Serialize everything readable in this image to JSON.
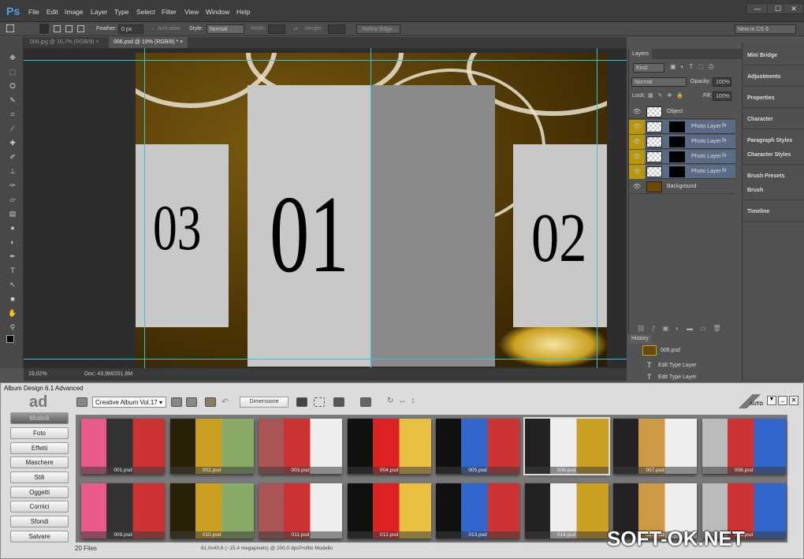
{
  "app": {
    "logo": "Ps",
    "menu": [
      "File",
      "Edit",
      "Image",
      "Layer",
      "Type",
      "Select",
      "Filter",
      "View",
      "Window",
      "Help"
    ],
    "window_controls": [
      "—",
      "☐",
      "✕"
    ]
  },
  "options": {
    "feather_label": "Feather:",
    "feather_value": "0 px",
    "antialias_label": "Anti-alias",
    "style_label": "Style:",
    "style_value": "Normal",
    "width_label": "Width:",
    "height_label": "Height:",
    "refine_edge": "Refine Edge...",
    "workspace": "New in CS 6"
  },
  "tabs": [
    {
      "label": "006.jpg @ 16,7% (RGB/8)",
      "close": "×"
    },
    {
      "label": "006.psd @ 19% (RGB/8) *",
      "close": "×"
    }
  ],
  "canvas": {
    "numbers": [
      "03",
      "01",
      "02"
    ]
  },
  "status": {
    "zoom": "19,02%",
    "doc": "Doc: 43,9M/201,6M"
  },
  "layers": {
    "tab": "Layers",
    "kind": "Kind",
    "blend": "Normal",
    "opacity_label": "Opacity:",
    "opacity": "100%",
    "lock_label": "Lock:",
    "fill_label": "Fill:",
    "fill": "100%",
    "items": [
      {
        "name": "Object",
        "selected": false
      },
      {
        "name": "Photo Layer",
        "selected": true
      },
      {
        "name": "Photo Layer",
        "selected": true
      },
      {
        "name": "Photo Layer",
        "selected": true
      },
      {
        "name": "Photo Layer",
        "selected": true
      },
      {
        "name": "Background",
        "selected": false
      }
    ],
    "fx": "fx"
  },
  "history": {
    "tab": "History",
    "items": [
      "006.psd",
      "Edit Type Layer",
      "Edit Type Layer"
    ]
  },
  "dock": [
    "Mini Bridge",
    "Adjustments",
    "Properties",
    "Character",
    "Paragraph Styles",
    "Character Styles",
    "Brush Presets",
    "Brush",
    "Timeline"
  ],
  "album": {
    "title": "Album Design 6.1 Advanced",
    "logo": "ad",
    "collection": "Creative Album Vol.17",
    "dimension_button": "Dimensione",
    "auto_label": "AUTO",
    "sidebar": [
      "Modelli",
      "Foto",
      "Effetti",
      "Maschere",
      "Stili",
      "Oggetti",
      "Cornici",
      "Sfondi",
      "Salvare"
    ],
    "active": "Modelli",
    "thumbnails": [
      "001.psd",
      "002.psd",
      "003.psd",
      "004.psd",
      "005.psd",
      "006.psd",
      "007.psd",
      "008.psd",
      "009.psd",
      "010.psd",
      "011.psd",
      "012.psd",
      "013.psd",
      "014.psd",
      "015.psd",
      "016.psd"
    ],
    "selected_thumbnail": "006.psd",
    "file_count": "20 Files",
    "info": "61,0x40,6 (~15,4 megapixels) @ 200,0 dpi.",
    "profile": "Profilo Modello"
  },
  "watermark": "SOFT-OK.NET",
  "colors": {
    "ps_bg": "#535353",
    "layer_selected": "#5a6b85",
    "eye_highlight": "#b8960a",
    "guide": "#2fc6d6"
  }
}
